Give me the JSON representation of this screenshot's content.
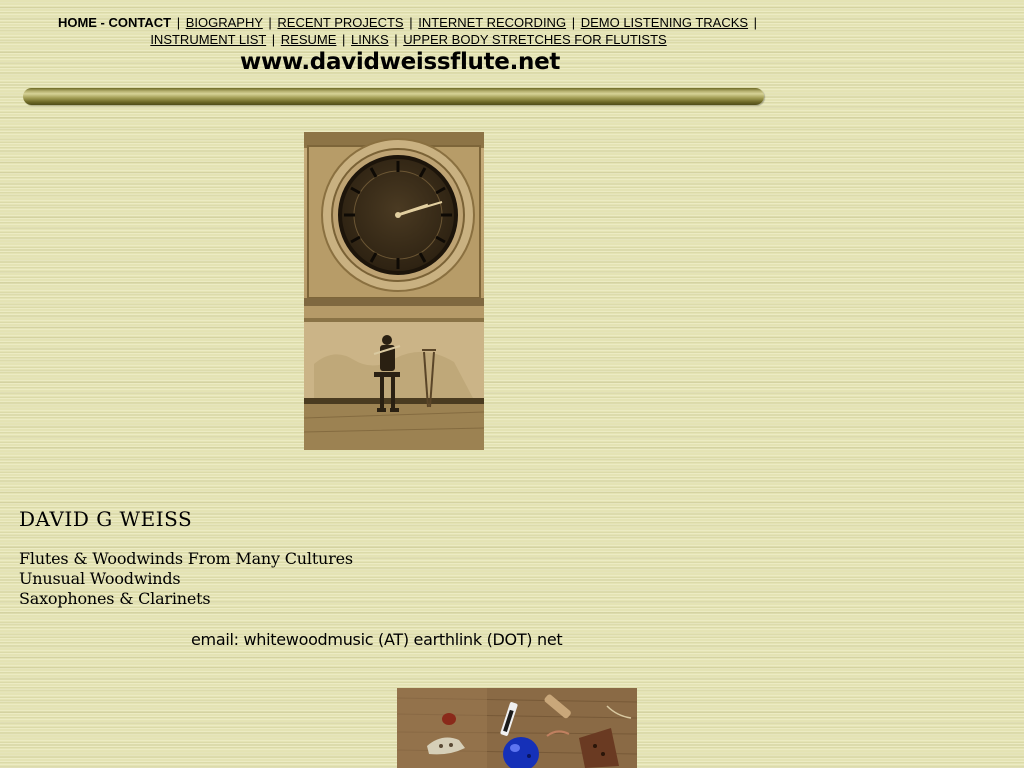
{
  "nav": {
    "home_contact": "HOME - CONTACT",
    "separator": "|",
    "links": [
      {
        "label": "BIOGRAPHY"
      },
      {
        "label": "RECENT PROJECTS"
      },
      {
        "label": "INTERNET RECORDING"
      },
      {
        "label": "DEMO LISTENING TRACKS"
      },
      {
        "label": "INSTRUMENT LIST"
      },
      {
        "label": "RESUME"
      },
      {
        "label": "LINKS"
      },
      {
        "label": "UPPER BODY STRETCHES FOR FLUTISTS"
      }
    ]
  },
  "header": {
    "site_url": "www.davidweissflute.net"
  },
  "images": {
    "clock_photo": "sepia-photo-clock-tower-musician",
    "instruments_photo": "photo-woodwind-instruments-on-wood"
  },
  "profile": {
    "name": "DAVID  G  WEISS",
    "specialties": [
      "Flutes & Woodwinds From Many Cultures",
      "Unusual Woodwinds",
      "Saxophones & Clarinets"
    ],
    "email": "email: whitewoodmusic (AT) earthlink (DOT) net"
  },
  "colors": {
    "page_background": "#e4e3b4",
    "divider": "#8a8540",
    "sepia": "#a88a55"
  }
}
